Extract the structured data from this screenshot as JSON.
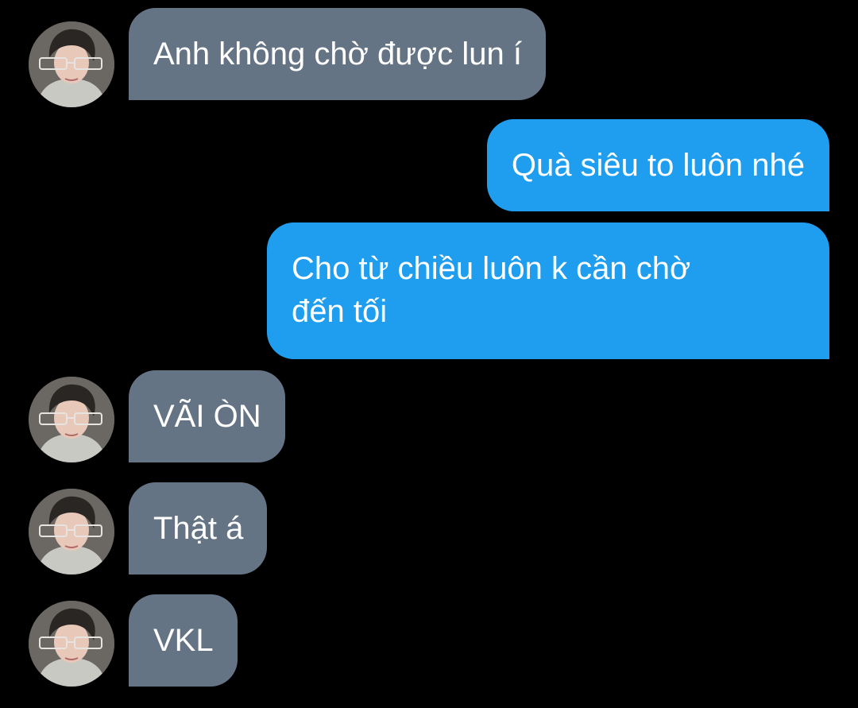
{
  "chat": {
    "colors": {
      "background": "#000000",
      "incoming_bubble": "#657484",
      "outgoing_bubble": "#1f9ef0",
      "text": "#ffffff"
    },
    "messages": [
      {
        "direction": "incoming",
        "text": "Anh không chờ được lun í",
        "avatar": "contact-avatar"
      },
      {
        "direction": "outgoing",
        "text": "Quà siêu to luôn nhé"
      },
      {
        "direction": "outgoing",
        "text_lines": [
          "Cho từ chiều luôn k cần chờ",
          "đến tối"
        ]
      },
      {
        "direction": "incoming",
        "text": "VÃI ÒN",
        "avatar": "contact-avatar"
      },
      {
        "direction": "incoming",
        "text": "Thật á",
        "avatar": "contact-avatar"
      },
      {
        "direction": "incoming",
        "text": "VKL",
        "avatar": "contact-avatar"
      }
    ]
  }
}
